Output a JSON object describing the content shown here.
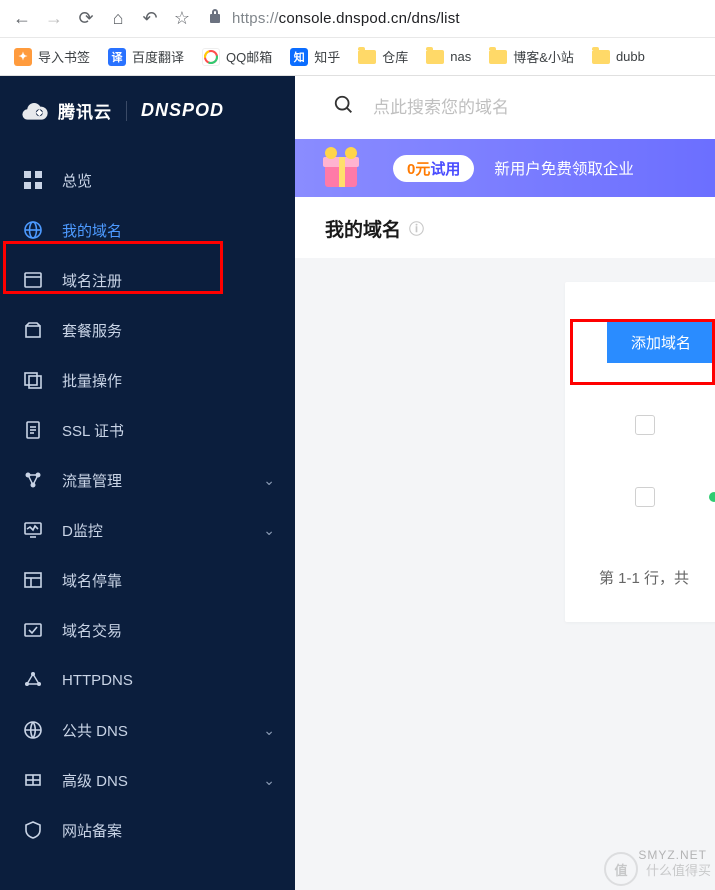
{
  "browser": {
    "url_protocol": "https://",
    "url_rest": "console.dnspod.cn/dns/list"
  },
  "bookmarks": [
    {
      "label": "导入书签",
      "icon_bg": "#ff9b3d",
      "icon_text": "✦"
    },
    {
      "label": "百度翻译",
      "icon_bg": "#2972ff",
      "icon_text": "译"
    },
    {
      "label": "QQ邮箱",
      "icon_bg": "#ffffff",
      "icon_text": "",
      "qq": true
    },
    {
      "label": "知乎",
      "icon_bg": "#0b6dff",
      "icon_text": "知"
    },
    {
      "label": "仓库",
      "folder": true
    },
    {
      "label": "nas",
      "folder": true
    },
    {
      "label": "博客&小站",
      "folder": true
    },
    {
      "label": "dubb",
      "folder": true
    }
  ],
  "brand": {
    "tencent": "腾讯云",
    "dnspod": "DNSPOD"
  },
  "sidebar": [
    {
      "id": "overview",
      "label": "总览",
      "icon": "grid"
    },
    {
      "id": "my-domains",
      "label": "我的域名",
      "icon": "globe",
      "active": true
    },
    {
      "id": "register",
      "label": "域名注册",
      "icon": "window"
    },
    {
      "id": "plans",
      "label": "套餐服务",
      "icon": "package"
    },
    {
      "id": "batch",
      "label": "批量操作",
      "icon": "stack"
    },
    {
      "id": "ssl",
      "label": "SSL 证书",
      "icon": "doc"
    },
    {
      "id": "traffic",
      "label": "流量管理",
      "icon": "nodes",
      "chevron": true
    },
    {
      "id": "dmonitor",
      "label": "D监控",
      "icon": "monitor",
      "chevron": true
    },
    {
      "id": "parking",
      "label": "域名停靠",
      "icon": "panel"
    },
    {
      "id": "trade",
      "label": "域名交易",
      "icon": "trade"
    },
    {
      "id": "httpdns",
      "label": "HTTPDNS",
      "icon": "dots"
    },
    {
      "id": "publicdns",
      "label": "公共 DNS",
      "icon": "world",
      "chevron": true
    },
    {
      "id": "advdns",
      "label": "高级 DNS",
      "icon": "adv",
      "chevron": true
    },
    {
      "id": "beian",
      "label": "网站备案",
      "icon": "shield"
    }
  ],
  "search": {
    "placeholder": "点此搜索您的域名"
  },
  "banner": {
    "pill_prefix": "0元",
    "pill_suffix": "试用",
    "text": "新用户免费领取企业"
  },
  "page": {
    "title": "我的域名",
    "add_button": "添加域名",
    "pager": "第 1-1 行，共"
  },
  "watermark": {
    "text": "什么值得买",
    "badge": "值",
    "site": "SMYZ.NET"
  }
}
